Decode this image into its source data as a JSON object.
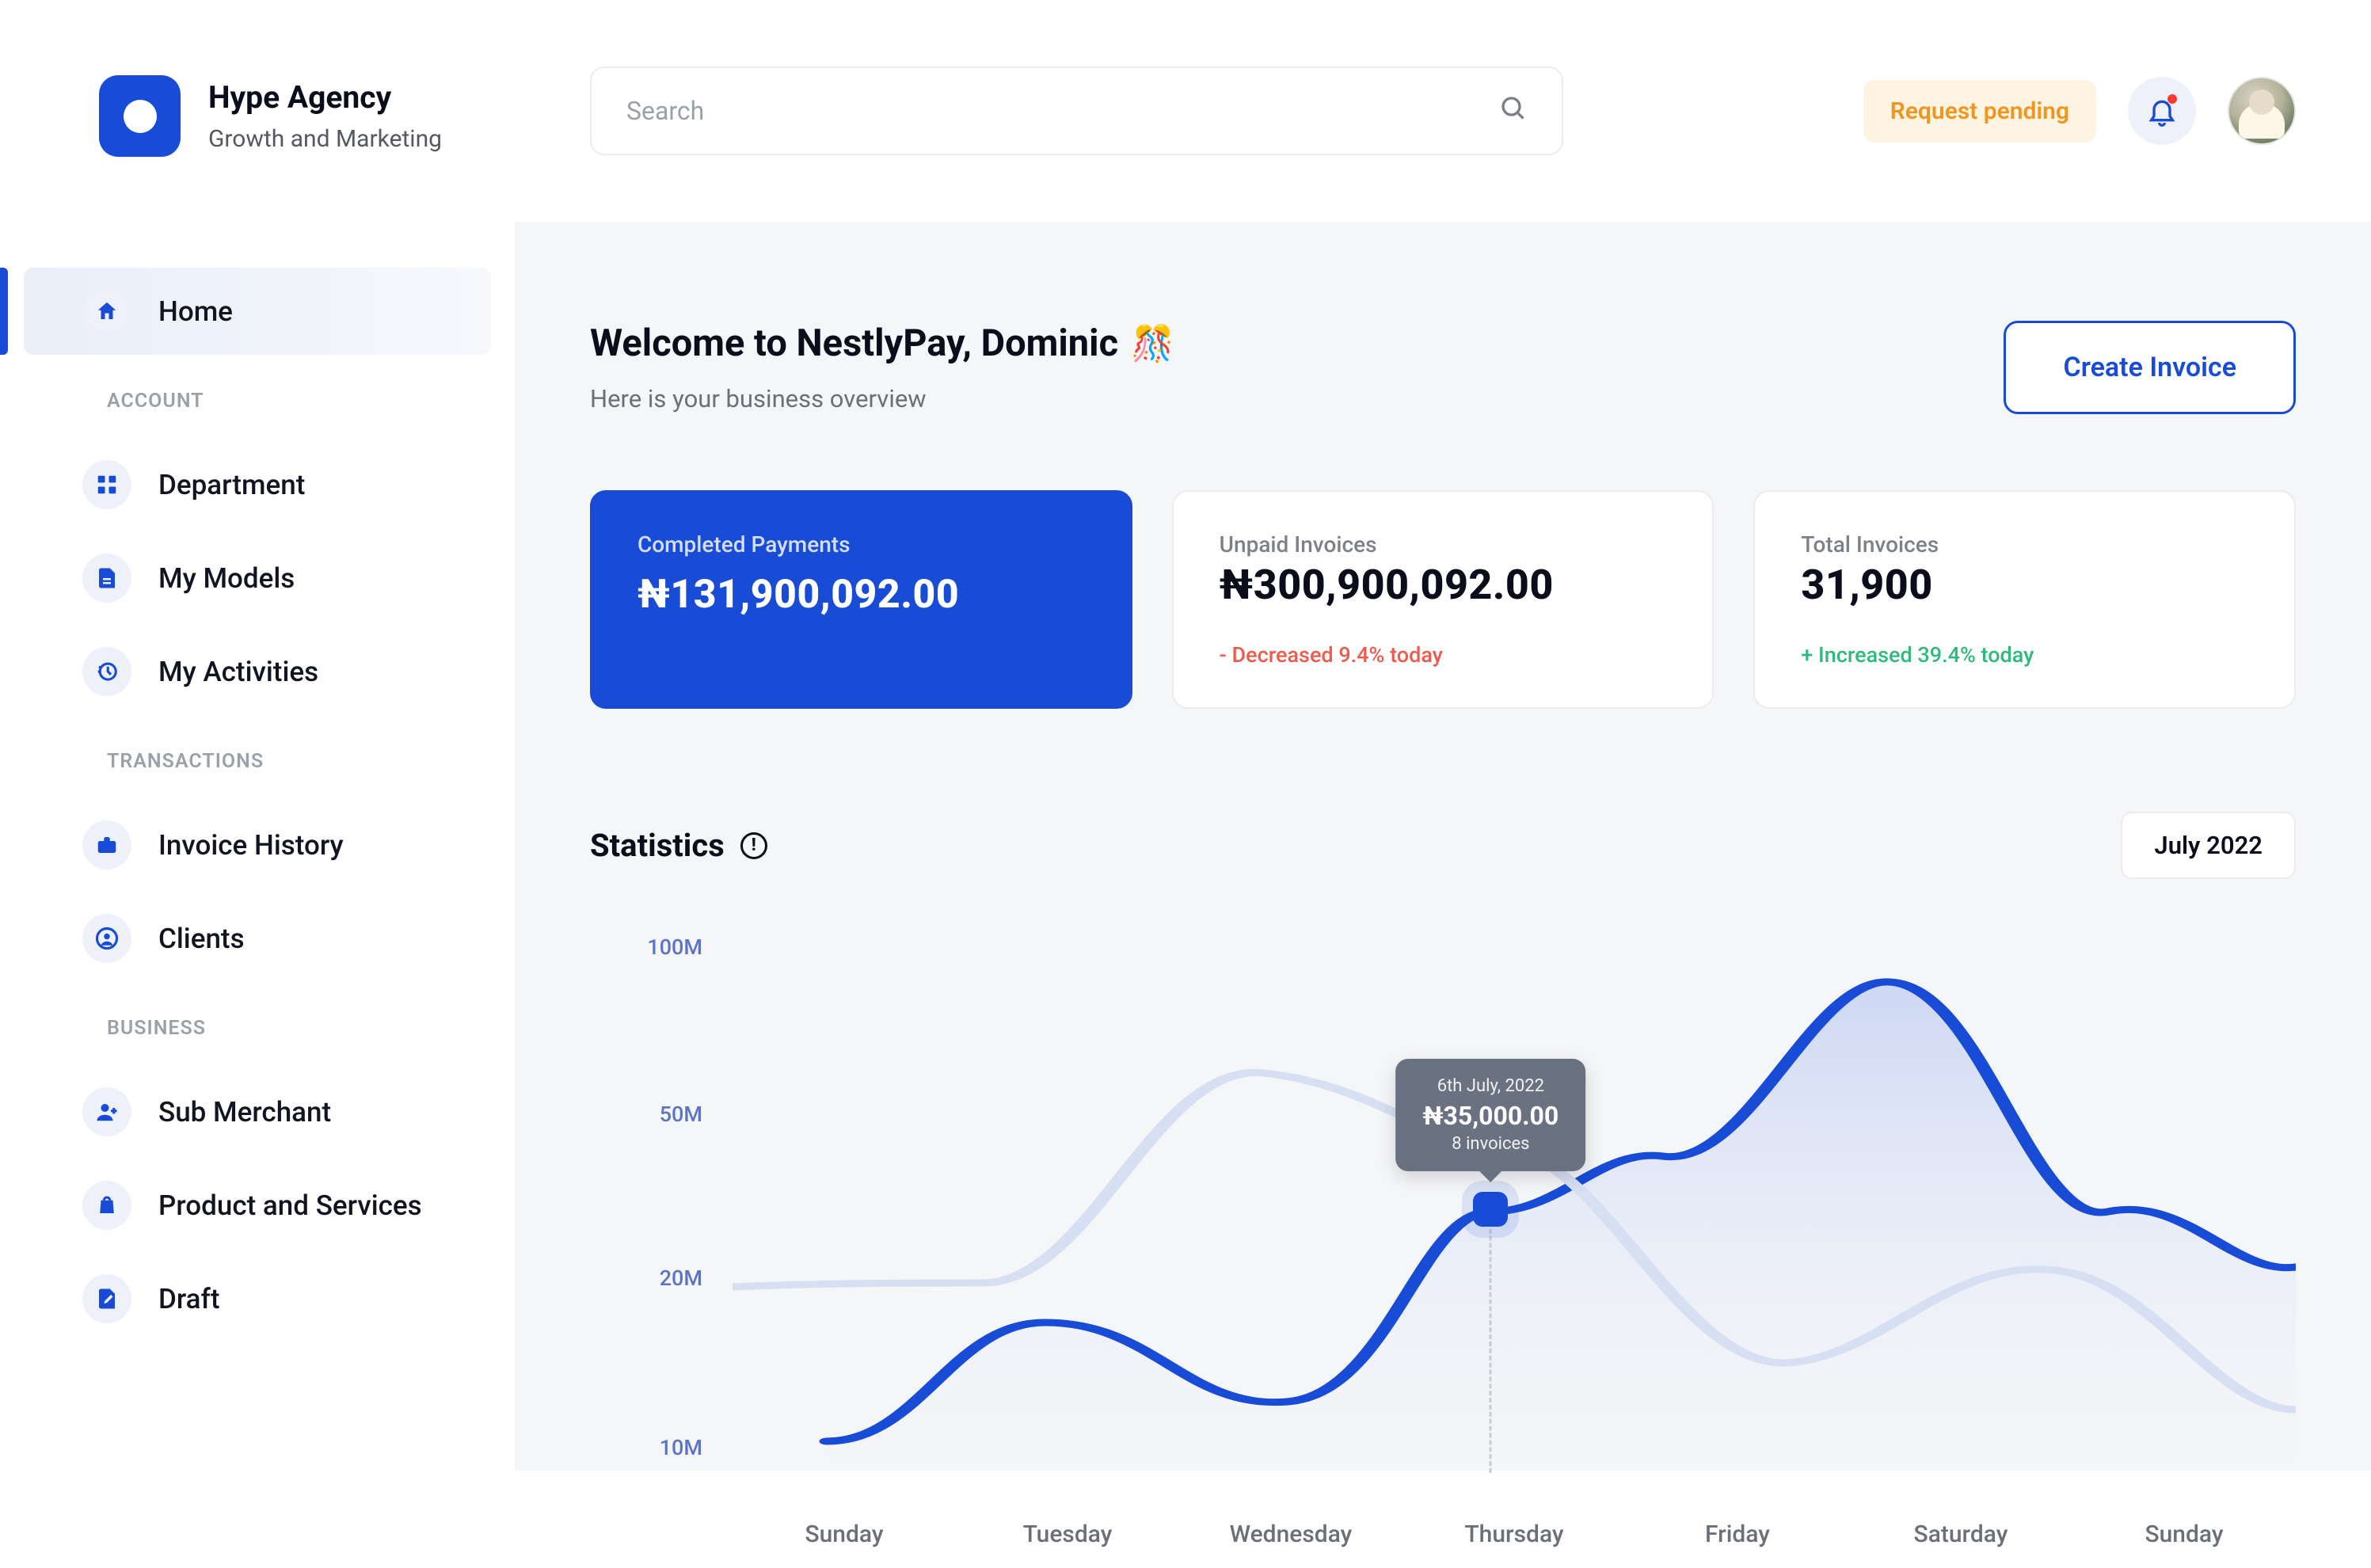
{
  "brand": {
    "title": "Hype Agency",
    "subtitle": "Growth and Marketing"
  },
  "sidebar": {
    "home": "Home",
    "sections": [
      {
        "label": "Account",
        "items": [
          {
            "name": "department",
            "label": "Department",
            "icon": "grid"
          },
          {
            "name": "my-models",
            "label": "My Models",
            "icon": "doc"
          },
          {
            "name": "my-activities",
            "label": "My Activities",
            "icon": "history"
          }
        ]
      },
      {
        "label": "Transactions",
        "items": [
          {
            "name": "invoice-history",
            "label": "Invoice History",
            "icon": "briefcase"
          },
          {
            "name": "clients",
            "label": "Clients",
            "icon": "user-circle"
          }
        ]
      },
      {
        "label": "Business",
        "items": [
          {
            "name": "sub-merchant",
            "label": "Sub Merchant",
            "icon": "user-add"
          },
          {
            "name": "product-services",
            "label": "Product and Services",
            "icon": "bag"
          },
          {
            "name": "draft",
            "label": "Draft",
            "icon": "file-edit"
          }
        ]
      }
    ]
  },
  "search": {
    "placeholder": "Search"
  },
  "topbar": {
    "request": "Request pending"
  },
  "welcome": {
    "title": "Welcome to NestlyPay, Dominic",
    "emoji": "🎊",
    "subtitle": "Here is your business overview",
    "cta": "Create Invoice"
  },
  "cards": {
    "completed": {
      "label": "Completed Payments",
      "value": "₦131,900,092.00"
    },
    "unpaid": {
      "label": "Unpaid Invoices",
      "value": "₦300,900,092.00",
      "trend": "- Decreased 9.4% today"
    },
    "total": {
      "label": "Total Invoices",
      "value": "31,900",
      "trend": "+ Increased 39.4% today"
    }
  },
  "stats": {
    "title": "Statistics",
    "period": "July 2022",
    "y_ticks": [
      "100M",
      "50M",
      "20M",
      "10M"
    ],
    "x_ticks": [
      "Sunday",
      "Tuesday",
      "Wednesday",
      "Thursday",
      "Friday",
      "Saturday",
      "Sunday"
    ],
    "tooltip": {
      "date": "6th July, 2022",
      "amount": "₦35,000.00",
      "sub": "8 invoices"
    }
  },
  "chart_data": {
    "type": "line",
    "title": "Statistics",
    "period": "July 2022",
    "xlabel": "",
    "ylabel": "",
    "y_ticks": [
      10,
      20,
      50,
      100
    ],
    "y_unit": "M",
    "categories": [
      "Sunday",
      "Tuesday",
      "Wednesday",
      "Thursday",
      "Friday",
      "Saturday",
      "Sunday"
    ],
    "currency": "₦",
    "series": [
      {
        "name": "primary",
        "values": [
          12,
          25,
          17,
          40,
          95,
          55,
          45
        ]
      },
      {
        "name": "secondary",
        "values": [
          20,
          20,
          50,
          45,
          22,
          36,
          17
        ]
      }
    ],
    "highlight": {
      "date": "6th July, 2022",
      "amount": 35000.0,
      "invoices": 8,
      "category_index": 3,
      "x_fraction": 0.485
    }
  }
}
